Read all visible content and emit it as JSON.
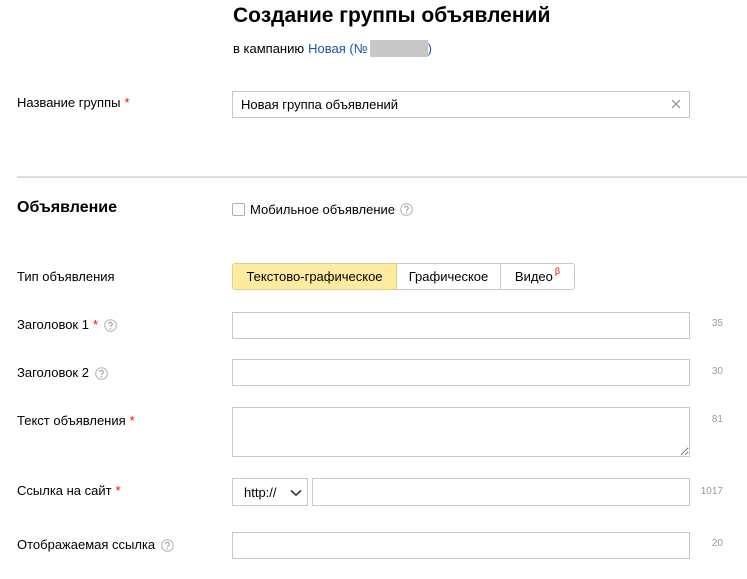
{
  "colors": {
    "link": "#1f52aa",
    "required": "#ff0000",
    "selected_segment_bg": "#ffeba0",
    "selected_segment_border": "#e2cf87",
    "border": "#c7c7c7",
    "divider": "#dcdcdc",
    "counter": "#999999",
    "redacted": "#c8c8c8"
  },
  "icons": {
    "clear": "clear-icon",
    "help": "question-icon",
    "select_arrow": "chevron-down-icon",
    "checkbox": "checkbox-unchecked"
  },
  "header": {
    "title": "Создание группы объявлений",
    "campaign_prefix": "в кампанию",
    "campaign_name": "Новая (№",
    "campaign_close": ")"
  },
  "group_name": {
    "label": "Название группы",
    "required_mark": "*",
    "value": "Новая группа объявлений"
  },
  "ad": {
    "heading": "Объявление",
    "mobile": {
      "label": "Мобильное объявление",
      "checked": false
    },
    "type": {
      "label": "Тип объявления",
      "options": [
        {
          "label": "Текстово-графическое",
          "selected": true
        },
        {
          "label": "Графическое",
          "selected": false
        },
        {
          "label": "Видео",
          "badge": "β",
          "selected": false
        }
      ]
    },
    "title1": {
      "label": "Заголовок 1",
      "required_mark": "*",
      "value": "",
      "counter": "35"
    },
    "title2": {
      "label": "Заголовок 2",
      "value": "",
      "counter": "30"
    },
    "text": {
      "label": "Текст объявления",
      "required_mark": "*",
      "value": "",
      "counter": "81"
    },
    "link": {
      "label": "Ссылка на сайт",
      "required_mark": "*",
      "protocol": "http://",
      "value": "",
      "counter": "1017"
    },
    "display_link": {
      "label": "Отображаемая ссылка",
      "value": "",
      "counter": "20"
    }
  }
}
